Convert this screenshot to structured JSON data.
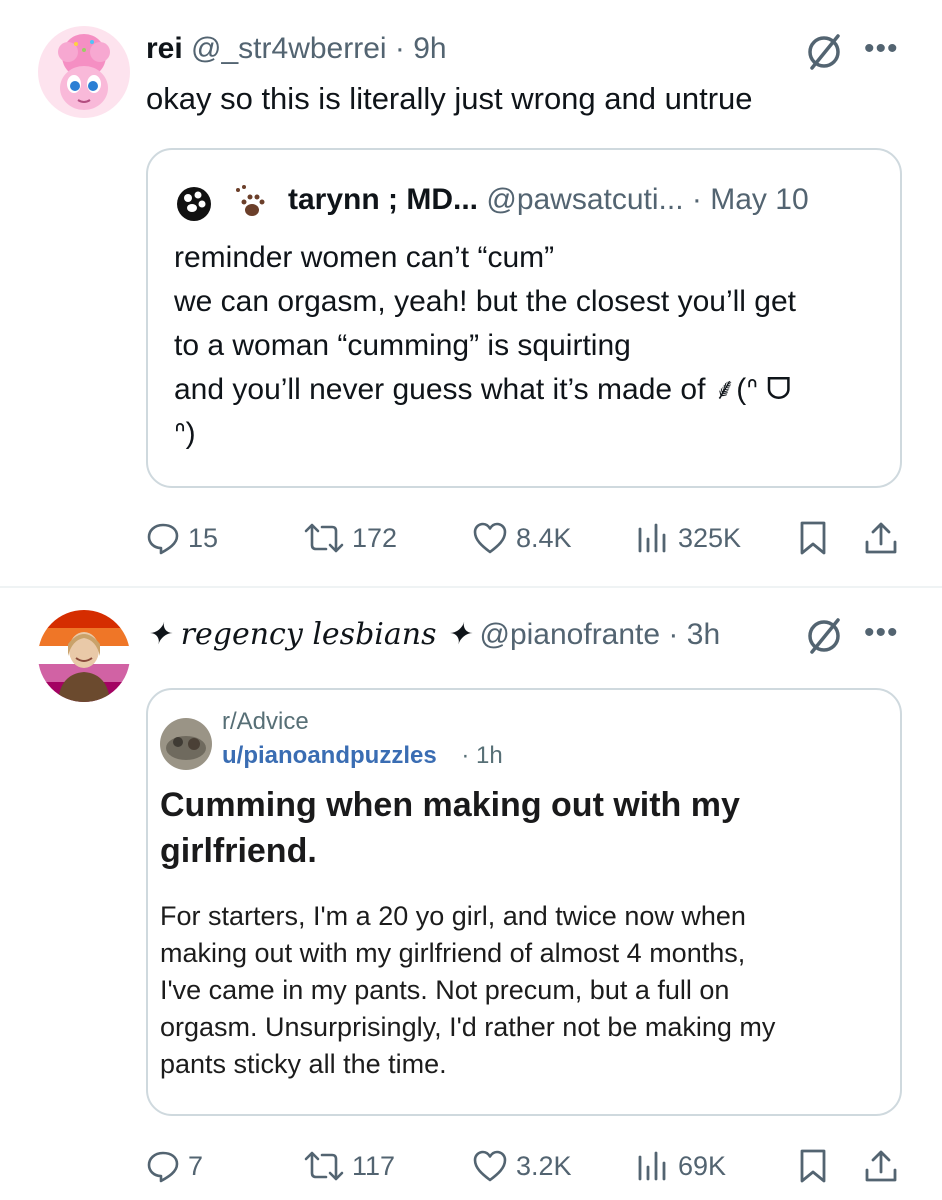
{
  "posts": [
    {
      "display_name": "rei",
      "handle": "@_str4wberrei",
      "separator": "·",
      "time": "9h",
      "text": "okay so this is literally just wrong and untrue",
      "quote": {
        "display_name": "tarynn ; MD...",
        "handle": "@pawsatcuti...",
        "separator": "·",
        "time": "May 10",
        "text": "reminder women can’t “cum”\nwe can orgasm, yeah! but the closest you’ll get\nto a woman “cumming” is squirting\nand you’ll never guess what it’s made of ⸙(ᐢ ᗜ\nᐢ)"
      },
      "actions": {
        "replies": "15",
        "reposts": "172",
        "likes": "8.4K",
        "views": "325K"
      }
    },
    {
      "display_name": "✦ regency lesbians ✦",
      "handle": "@pianofrante",
      "separator": "·",
      "time": "3h",
      "reddit": {
        "subreddit": "r/Advice",
        "user": "u/pianoandpuzzles",
        "separator": "·",
        "time": "1h",
        "title": "Cumming when making out with my\ngirlfriend.",
        "body": "For starters, I'm a 20 yo girl, and twice now when\nmaking out with my girlfriend of almost 4 months,\nI've came in my pants. Not precum, but a full on\norgasm. Unsurprisingly, I'd rather not be making my\npants sticky all the time."
      },
      "actions": {
        "replies": "7",
        "reposts": "117",
        "likes": "3.2K",
        "views": "69K"
      }
    }
  ],
  "icons": {
    "mute": "muted-circle-slash-icon",
    "more": "more-dots-icon",
    "reply": "reply-bubble-icon",
    "repost": "repost-arrows-icon",
    "like": "heart-icon",
    "views": "views-bars-icon",
    "bookmark": "bookmark-icon",
    "share": "share-upload-icon"
  },
  "colors": {
    "text": "#0f1419",
    "secondary": "#536471",
    "border": "#cfd9de",
    "reddit_link": "#3a6db3"
  }
}
